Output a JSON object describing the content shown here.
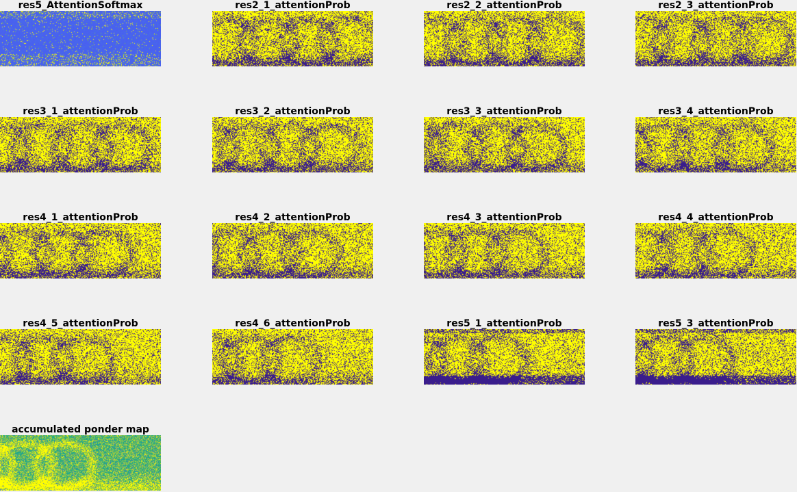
{
  "figure": {
    "background": "#f0f0f0",
    "colormap": {
      "low": "#3a1d8c",
      "mid_blue": "#4a5ff0",
      "teal": "#22a88a",
      "green": "#7fc24a",
      "high": "#ffff00"
    },
    "panels": [
      {
        "title": "res5_AttentionSoftmax",
        "style": "softmax-blue",
        "icon": "attention-heatmap"
      },
      {
        "title": "res2_1_attentionProb",
        "style": "binary",
        "icon": "attention-heatmap"
      },
      {
        "title": "res2_2_attentionProb",
        "style": "binary",
        "icon": "attention-heatmap"
      },
      {
        "title": "res2_3_attentionProb",
        "style": "binary",
        "icon": "attention-heatmap"
      },
      {
        "title": "res3_1_attentionProb",
        "style": "binary",
        "icon": "attention-heatmap"
      },
      {
        "title": "res3_2_attentionProb",
        "style": "binary",
        "icon": "attention-heatmap"
      },
      {
        "title": "res3_3_attentionProb",
        "style": "binary",
        "icon": "attention-heatmap"
      },
      {
        "title": "res3_4_attentionProb",
        "style": "binary",
        "icon": "attention-heatmap"
      },
      {
        "title": "res4_1_attentionProb",
        "style": "binary",
        "icon": "attention-heatmap"
      },
      {
        "title": "res4_2_attentionProb",
        "style": "binary",
        "icon": "attention-heatmap"
      },
      {
        "title": "res4_3_attentionProb",
        "style": "binary",
        "icon": "attention-heatmap"
      },
      {
        "title": "res4_4_attentionProb",
        "style": "binary",
        "icon": "attention-heatmap"
      },
      {
        "title": "res4_5_attentionProb",
        "style": "binary",
        "icon": "attention-heatmap"
      },
      {
        "title": "res4_6_attentionProb",
        "style": "binary",
        "icon": "attention-heatmap"
      },
      {
        "title": "res5_1_attentionProb",
        "style": "binary-dense",
        "icon": "attention-heatmap"
      },
      {
        "title": "res5_3_attentionProb",
        "style": "binary-dense",
        "icon": "attention-heatmap"
      },
      {
        "title": "accumulated ponder map",
        "style": "ponder",
        "icon": "ponder-heatmap"
      }
    ]
  }
}
